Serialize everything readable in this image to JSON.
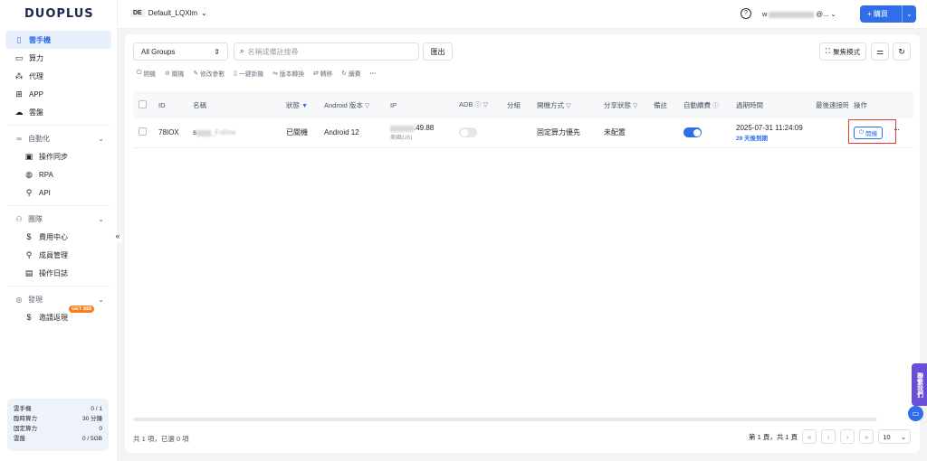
{
  "brand": {
    "logo": "DUOPLUS"
  },
  "sidebar": {
    "items": [
      {
        "icon": "cloud-phone-icon",
        "label": "雲手機",
        "active": true
      },
      {
        "icon": "monitor-icon",
        "label": "算力"
      },
      {
        "icon": "proxy-icon",
        "label": "代理"
      },
      {
        "icon": "app-grid-icon",
        "label": "APP"
      },
      {
        "icon": "cloud-icon",
        "label": "雲盤"
      }
    ],
    "automation": {
      "label": "自動化",
      "items": [
        "操作同步",
        "RPA",
        "API"
      ]
    },
    "team": {
      "label": "團隊",
      "items": [
        "費用中心",
        "成員管理",
        "操作日誌"
      ]
    },
    "discover": {
      "label": "發現",
      "items": [
        "邀請返現"
      ],
      "badge": "GET $$$"
    },
    "collapse": "«",
    "stats": [
      {
        "label": "雲手機",
        "value": "0 / 1"
      },
      {
        "label": "臨時算力",
        "value": "30 分鐘"
      },
      {
        "label": "固定算力",
        "value": "0"
      },
      {
        "label": "雲盤",
        "value": "0 / 5GB"
      }
    ]
  },
  "topbar": {
    "env_tag": "DE",
    "env_name": "Default_LQXlm",
    "user_prefix": "w",
    "user_suffix": "@...",
    "buy_label": "+ 購買"
  },
  "toolbar": {
    "group_select": "All Groups",
    "search_placeholder": "名稱或備註搜尋",
    "export_label": "匯出",
    "focus_label": "聚焦模式",
    "actions": [
      "開機",
      "關機",
      "修改參數",
      "一鍵新機",
      "版本轉換",
      "轉移",
      "續費",
      "···"
    ]
  },
  "table": {
    "headers": [
      "ID",
      "名稱",
      "狀態",
      "Android 版本",
      "IP",
      "ADB",
      "分組",
      "開機方式",
      "分享狀態",
      "備註",
      "自動續費",
      "過期時間",
      "最後連接時",
      "操作"
    ],
    "rows": [
      {
        "id": "78IOX",
        "name_visible": "s",
        "name_tail": "_Follow",
        "status": "已關機",
        "android": "Android 12",
        "ip_tail": ".49.88",
        "ip_region": "美國(US)",
        "adb": false,
        "group": "",
        "boot_mode": "固定算力優先",
        "share_status": "未配置",
        "note": "",
        "auto_renew": true,
        "expire_date": "2025-07-31 11:24:09",
        "expire_in": "29 天後到期",
        "last_connect": "",
        "action_label": "開機",
        "more_label": "···"
      }
    ]
  },
  "footer": {
    "summary": "共 1 項，已選 0 項",
    "page_info": "第 1 頁，共 1 頁",
    "page_size": "10"
  },
  "float": {
    "contact": "聯繫我們"
  },
  "colors": {
    "accent": "#2f6ee8",
    "highlight_box": "#e53935",
    "badge": "#ff7a1a"
  }
}
